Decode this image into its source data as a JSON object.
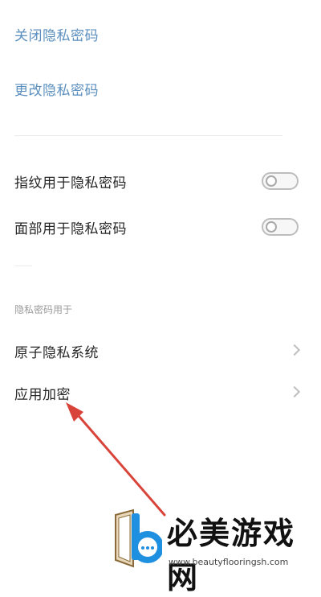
{
  "top_links": [
    {
      "label": "关闭隐私密码"
    },
    {
      "label": "更改隐私密码"
    }
  ],
  "toggles": [
    {
      "label": "指纹用于隐私密码",
      "on": false
    },
    {
      "label": "面部用于隐私密码",
      "on": false
    }
  ],
  "section": {
    "header": "隐私密码用于",
    "items": [
      {
        "label": "原子隐私系统"
      },
      {
        "label": "应用加密"
      }
    ]
  },
  "watermark": {
    "title": "必美游戏网",
    "url": "www.beautyflooringsh.com"
  },
  "colors": {
    "link": "#5b8fbf",
    "annotation_arrow": "#d9443a"
  }
}
